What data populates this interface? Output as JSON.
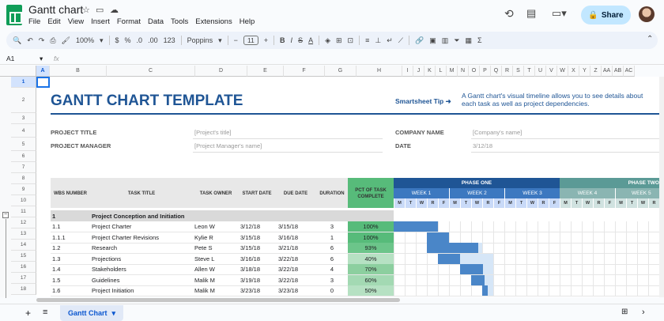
{
  "app": {
    "title": "Gantt chart",
    "menu": [
      "File",
      "Edit",
      "View",
      "Insert",
      "Format",
      "Data",
      "Tools",
      "Extensions",
      "Help"
    ],
    "share_label": "Share"
  },
  "toolbar": {
    "zoom": "100%",
    "font": "Poppins",
    "font_size": "11",
    "currency": "$",
    "percent": "%",
    "decimals_dec": ".0",
    "decimals_inc": ".00",
    "number_format": "123"
  },
  "formula": {
    "cell_ref": "A1",
    "fx": "fx",
    "value": ""
  },
  "columns": [
    "A",
    "B",
    "C",
    "D",
    "E",
    "F",
    "G",
    "H",
    "I",
    "J",
    "K",
    "L",
    "M",
    "N",
    "O",
    "P",
    "Q",
    "R",
    "S",
    "T",
    "U",
    "V",
    "W",
    "X",
    "Y",
    "Z",
    "AA",
    "AB",
    "AC"
  ],
  "rows": [
    "1",
    "2",
    "3",
    "4",
    "5",
    "6",
    "7",
    "8",
    "9",
    "10",
    "11",
    "12",
    "13",
    "14",
    "15",
    "16",
    "17",
    "18"
  ],
  "sheet": {
    "title": "GANTT CHART TEMPLATE",
    "tip_label": "Smartsheet Tip ➜",
    "tip_text": "A Gantt chart's visual timeline allows you to see details about each task as well as project dependencies.",
    "project_title_label": "PROJECT TITLE",
    "project_title_value": "[Project's title]",
    "project_manager_label": "PROJECT MANAGER",
    "project_manager_value": "[Project Manager's name]",
    "company_label": "COMPANY NAME",
    "company_value": "[Company's name]",
    "date_label": "DATE",
    "date_value": "3/12/18",
    "headers": {
      "wbs": "WBS NUMBER",
      "task": "TASK TITLE",
      "owner": "TASK OWNER",
      "start": "START DATE",
      "due": "DUE DATE",
      "duration": "DURATION",
      "pct": "PCT OF TASK COMPLETE"
    },
    "phase1": "PHASE ONE",
    "phase2": "PHASE TWO",
    "weeks": [
      "WEEK 1",
      "WEEK 2",
      "WEEK 3",
      "WEEK 4",
      "WEEK 5"
    ],
    "days": [
      "M",
      "T",
      "W",
      "R",
      "F"
    ],
    "section": {
      "wbs": "1",
      "title": "Project Conception and Initiation"
    },
    "tasks": [
      {
        "wbs": "1.1",
        "title": "Project Charter",
        "owner": "Leon W",
        "start": "3/12/18",
        "due": "3/15/18",
        "duration": "3",
        "pct": "100%"
      },
      {
        "wbs": "1.1.1",
        "title": "Project Charter Revisions",
        "owner": "Kylie R",
        "start": "3/15/18",
        "due": "3/16/18",
        "duration": "1",
        "pct": "100%"
      },
      {
        "wbs": "1.2",
        "title": "Research",
        "owner": "Pete S",
        "start": "3/15/18",
        "due": "3/21/18",
        "duration": "6",
        "pct": "93%"
      },
      {
        "wbs": "1.3",
        "title": "Projections",
        "owner": "Steve L",
        "start": "3/16/18",
        "due": "3/22/18",
        "duration": "6",
        "pct": "40%"
      },
      {
        "wbs": "1.4",
        "title": "Stakeholders",
        "owner": "Allen W",
        "start": "3/18/18",
        "due": "3/22/18",
        "duration": "4",
        "pct": "70%"
      },
      {
        "wbs": "1.5",
        "title": "Guidelines",
        "owner": "Malik M",
        "start": "3/19/18",
        "due": "3/22/18",
        "duration": "3",
        "pct": "60%"
      },
      {
        "wbs": "1.6",
        "title": "Project Initiation",
        "owner": "Malik M",
        "start": "3/23/18",
        "due": "3/23/18",
        "duration": "0",
        "pct": "50%"
      }
    ]
  },
  "bottom": {
    "sheet_tab": "Gantt Chart"
  },
  "colors": {
    "title_blue": "#1f5595",
    "phase1": "#1f5595",
    "week_ph1": "#3c78c0",
    "phase2": "#5b9a96",
    "week_ph2": "#8ab5b2",
    "pct_dark": "#57bb7a",
    "pct_light": "#b6e1c3",
    "bar_dark": "#4a86c8",
    "bar_light": "#d6e6f7"
  }
}
